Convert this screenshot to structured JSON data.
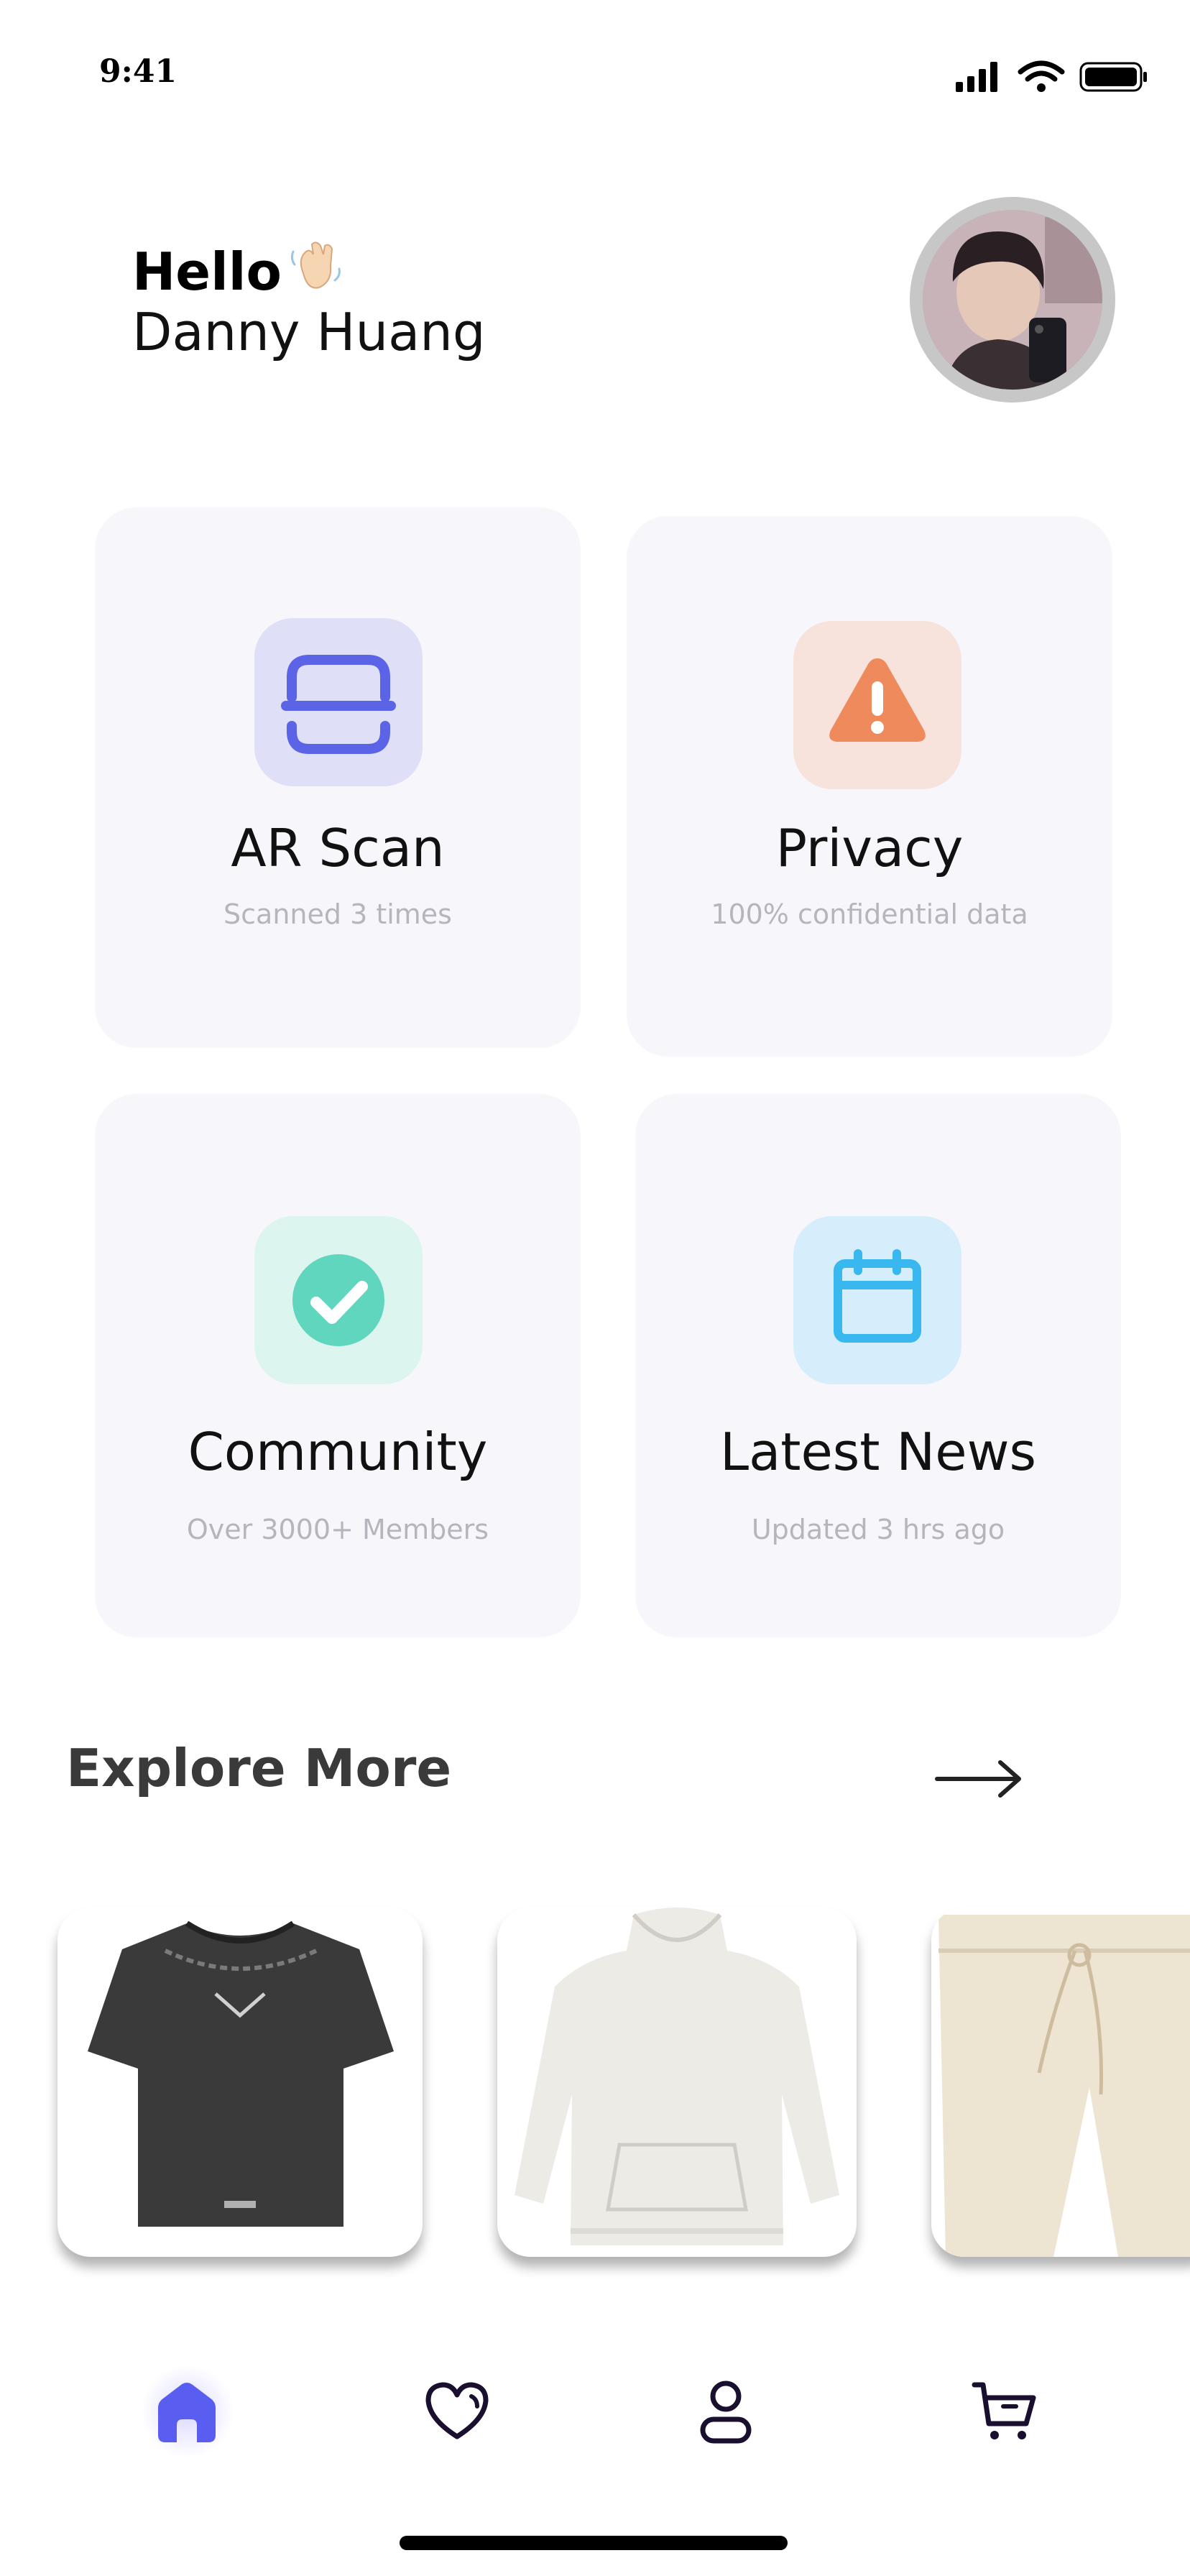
{
  "status_bar": {
    "time": "9:41"
  },
  "greeting": {
    "hello": "Hello",
    "wave_emoji": "👋🏻",
    "name": "Danny Huang"
  },
  "cards": [
    {
      "title": "AR Scan",
      "subtitle": "Scanned 3 times",
      "icon": "scan-icon",
      "icon_bg": "#dfdff8",
      "icon_color": "#5b63e6"
    },
    {
      "title": "Privacy",
      "subtitle": "100% confidential data",
      "icon": "warning-icon",
      "icon_bg": "#f7e3dc",
      "icon_color": "#ef8a5c"
    },
    {
      "title": "Community",
      "subtitle": "Over 3000+ Members",
      "icon": "check-circle-icon",
      "icon_bg": "#dcf5ef",
      "icon_color": "#5fd6bd"
    },
    {
      "title": "Latest News",
      "subtitle": "Updated 3 hrs ago",
      "icon": "calendar-icon",
      "icon_bg": "#d6eefb",
      "icon_color": "#38b8ee"
    }
  ],
  "explore": {
    "title": "Explore More"
  },
  "products": [
    {
      "name": "tshirt-product",
      "color": "#3a3a3a"
    },
    {
      "name": "hoodie-product",
      "color": "#ecebe6"
    },
    {
      "name": "shorts-product",
      "color": "#ede4d2"
    }
  ],
  "nav": {
    "items": [
      "home-icon",
      "heart-icon",
      "profile-icon",
      "cart-icon"
    ],
    "active": "home-icon",
    "active_color": "#5a5ef0",
    "inactive_color": "#1a0f2e"
  }
}
